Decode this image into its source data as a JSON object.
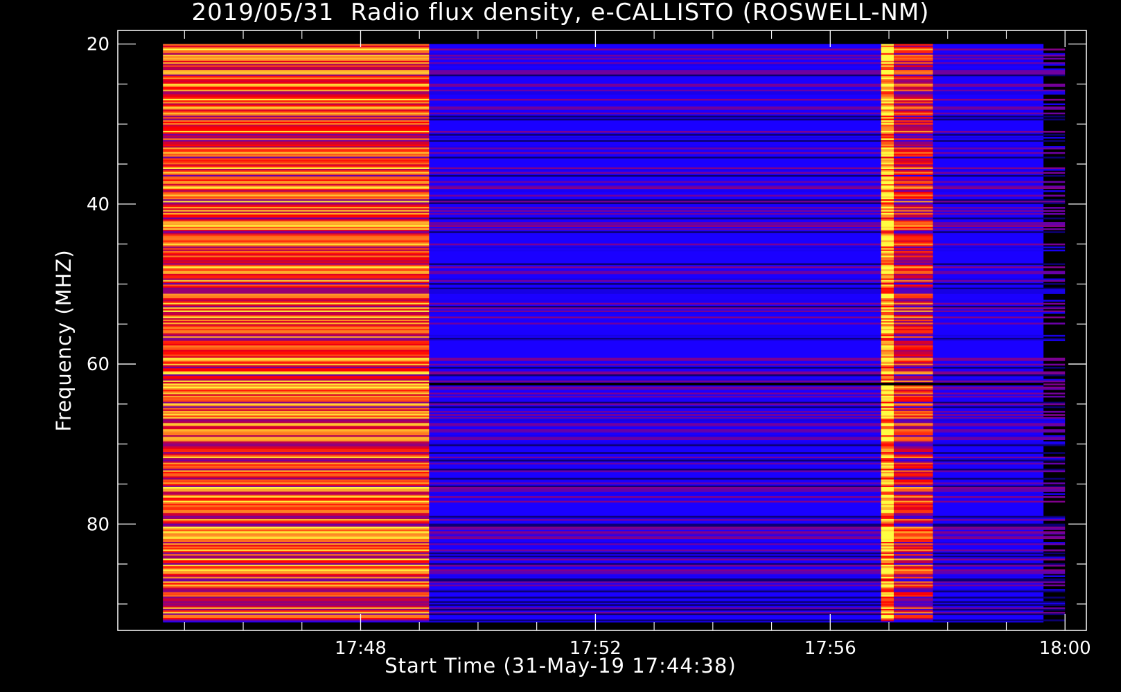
{
  "chart_data": {
    "type": "heatmap",
    "title": "2019/05/31  Radio flux density, e-CALLISTO (ROSWELL-NM)",
    "xlabel": "Start Time (31-May-19 17:44:38)",
    "ylabel": "Frequency (MHZ)",
    "x_ticks": [
      "17:48",
      "17:52",
      "17:56",
      "18:00"
    ],
    "y_ticks": [
      20,
      40,
      60,
      80
    ],
    "xlim_minutes_after_start": [
      -0.77,
      15.73
    ],
    "data_x_range_minutes_after_start": [
      0,
      15
    ],
    "ylim": [
      18.3,
      93.3
    ],
    "y_axis_inverted": true,
    "segments": [
      {
        "label": "intense broadband emission",
        "start": "17:44:38",
        "end": "17:49:10",
        "level": "high"
      },
      {
        "label": "background",
        "start": "17:49:10",
        "end": "17:56:52",
        "level": "low"
      },
      {
        "label": "short vertical burst",
        "start": "17:56:52",
        "end": "17:57:05",
        "level": "very high"
      },
      {
        "label": "moderate emission",
        "start": "17:57:05",
        "end": "17:57:45",
        "level": "medium"
      },
      {
        "label": "background",
        "start": "17:57:45",
        "end": "18:00:00",
        "level": "low"
      }
    ],
    "persistent_line_mhz": 62.5,
    "colormap": [
      "#000000",
      "#1a00ff",
      "#ff0000",
      "#ffff40"
    ],
    "grid": false
  }
}
